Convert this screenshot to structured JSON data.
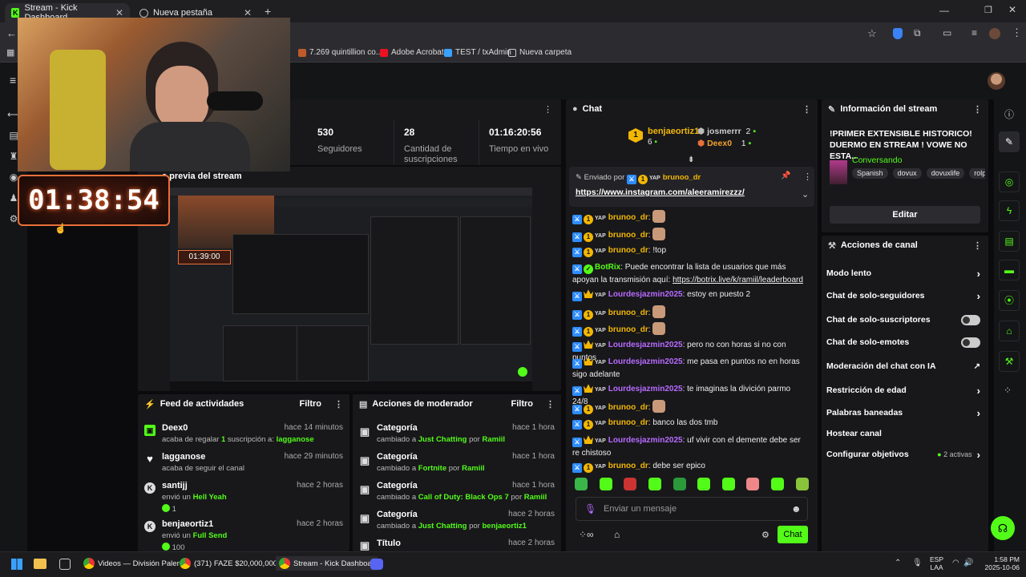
{
  "browser": {
    "tabs": [
      {
        "title": "Stream - Kick Dashboard",
        "active": true
      },
      {
        "title": "Nueva pestaña",
        "active": false
      }
    ],
    "bookmarks": [
      "7.269 quintillion co...",
      "Adobe Acrobat",
      "TEST / txAdmin",
      "Nueva carpeta"
    ]
  },
  "overlay": {
    "timer_main": "01:38:54",
    "timer_preview": "01:39:00"
  },
  "stats": [
    {
      "value": "530",
      "label": "Seguidores"
    },
    {
      "value": "28",
      "label": "Cantidad de suscripciones"
    },
    {
      "value": "01:16:20:56",
      "label": "Tiempo en vivo"
    }
  ],
  "preview": {
    "title": "a previa del stream"
  },
  "feed": {
    "title": "Feed de actividades",
    "filter": "Filtro",
    "items": [
      {
        "name": "Deex0",
        "time": "hace 14 minutos",
        "text": "acaba de regalar ",
        "highlight": "1",
        "text2": " suscripción a: ",
        "highlight2": "lagganose",
        "icon": "gift-icon"
      },
      {
        "name": "lagganose",
        "time": "hace 29 minutos",
        "text": "acaba de seguir el canal",
        "highlight": "",
        "text2": "",
        "highlight2": "",
        "icon": "heart-icon"
      },
      {
        "name": "santijj",
        "time": "hace 2 horas",
        "text": "envió un ",
        "highlight": "Hell Yeah",
        "text2": "",
        "highlight2": "",
        "amount": "1",
        "icon": "kick-icon"
      },
      {
        "name": "benjaeortiz1",
        "time": "hace 2 horas",
        "text": "envió un ",
        "highlight": "Full Send",
        "text2": "",
        "highlight2": "",
        "amount": "100",
        "icon": "kick-icon"
      }
    ]
  },
  "modactions": {
    "title": "Acciones de moderador",
    "filter": "Filtro",
    "items": [
      {
        "name": "Categoría",
        "time": "hace 1 hora",
        "pre": "cambiado a ",
        "value": "Just Chatting",
        "by": " por ",
        "user": "Ramiil"
      },
      {
        "name": "Categoría",
        "time": "hace 1 hora",
        "pre": "cambiado a ",
        "value": "Fortnite",
        "by": " por ",
        "user": "Ramiil"
      },
      {
        "name": "Categoría",
        "time": "hace 1 hora",
        "pre": "cambiado a ",
        "value": "Call of Duty: Black Ops 7",
        "by": " por ",
        "user": "Ramiil"
      },
      {
        "name": "Categoría",
        "time": "hace 2 horas",
        "pre": "cambiado a ",
        "value": "Just Chatting",
        "by": " por ",
        "user": "benjaeortiz1"
      },
      {
        "name": "Título",
        "time": "hace 2 horas",
        "pre": "",
        "value": "",
        "by": "",
        "user": ""
      }
    ]
  },
  "chat": {
    "title": "Chat",
    "leaders": {
      "first": {
        "name": "benjaeortiz1",
        "count": "6",
        "rank": "1"
      },
      "second": {
        "name": "josmerrr",
        "count": "2"
      },
      "third": {
        "name": "Deex0",
        "count": "1"
      }
    },
    "pinned": {
      "by_label": "Enviado por",
      "user": "brunoo_dr",
      "link": "https://www.instagram.com/aleeramirezzz/"
    },
    "messages": [
      {
        "user": "brunoo_dr",
        "color": "gold",
        "text": "",
        "emote": true
      },
      {
        "user": "brunoo_dr",
        "color": "gold",
        "text": "",
        "emote": true
      },
      {
        "user": "brunoo_dr",
        "color": "gold",
        "text": "!top",
        "emote": false
      },
      {
        "user": "BotRix",
        "color": "green",
        "text": "Puede encontrar la lista de usuarios que más apoyan la transmisión aquí: ",
        "link": "https://botrix.live/k/ramiil/leaderboard",
        "emote": false
      },
      {
        "user": "Lourdesjazmin2025",
        "color": "purple",
        "text": "estoy en puesto 2 ",
        "emote": false
      },
      {
        "user": "brunoo_dr",
        "color": "gold",
        "text": "",
        "emote": true
      },
      {
        "user": "brunoo_dr",
        "color": "gold",
        "text": "",
        "emote": true
      },
      {
        "user": "Lourdesjazmin2025",
        "color": "purple",
        "text": "pero no con horas si no con puntos",
        "emote": false
      },
      {
        "user": "Lourdesjazmin2025",
        "color": "purple",
        "text": "me pasa en puntos no en horas sigo adelante",
        "emote": false
      },
      {
        "user": "Lourdesjazmin2025",
        "color": "purple",
        "text": "te imaginas la divición parmo 24/8",
        "emote": false
      },
      {
        "user": "brunoo_dr",
        "color": "gold",
        "text": "",
        "emote": true
      },
      {
        "user": "brunoo_dr",
        "color": "gold",
        "text": "banco las dos tmb",
        "emote": false
      },
      {
        "user": "Lourdesjazmin2025",
        "color": "purple",
        "text": "uf vivir con el demente debe ser re chistoso",
        "emote": false
      },
      {
        "user": "brunoo_dr",
        "color": "gold",
        "text": "debe ser epico",
        "emote": false
      }
    ],
    "input_placeholder": "Enviar un mensaje",
    "send_label": "Chat"
  },
  "streaminfo": {
    "title": "Información del stream",
    "stream_title": "!PRIMER EXTENSIBLE HISTORICO! DUERMO EN STREAM ! VOWE NO ESTA...",
    "category": "Conversando",
    "tags": [
      "Spanish",
      "dovux",
      "dovuxlife",
      "rolpl"
    ],
    "edit_label": "Editar"
  },
  "channel_actions": {
    "title": "Acciones de canal",
    "items": [
      {
        "label": "Modo lento",
        "kind": "chevron"
      },
      {
        "label": "Chat de solo-seguidores",
        "kind": "chevron"
      },
      {
        "label": "Chat de solo-suscriptores",
        "kind": "toggle"
      },
      {
        "label": "Chat de solo-emotes",
        "kind": "toggle"
      },
      {
        "label": "Moderación del chat con IA",
        "kind": "external"
      },
      {
        "label": "Restricción de edad",
        "kind": "chevron"
      },
      {
        "label": "Palabras baneadas",
        "kind": "chevron"
      },
      {
        "label": "Hostear canal",
        "kind": "none"
      },
      {
        "label": "Configurar objetivos",
        "kind": "chevron",
        "extra": "2 activas"
      }
    ]
  },
  "taskbar": {
    "items": [
      "Videos — División Paler",
      "(371) FAZE $20,000,000 :",
      "Stream - Kick Dashboar"
    ],
    "lang": "ESP",
    "region": "LAA",
    "time": "1:58 PM",
    "date": "2025-10-06"
  },
  "colors": {
    "accent": "#53fc18",
    "panel": "#18181b",
    "bg": "#0b0b0d"
  }
}
